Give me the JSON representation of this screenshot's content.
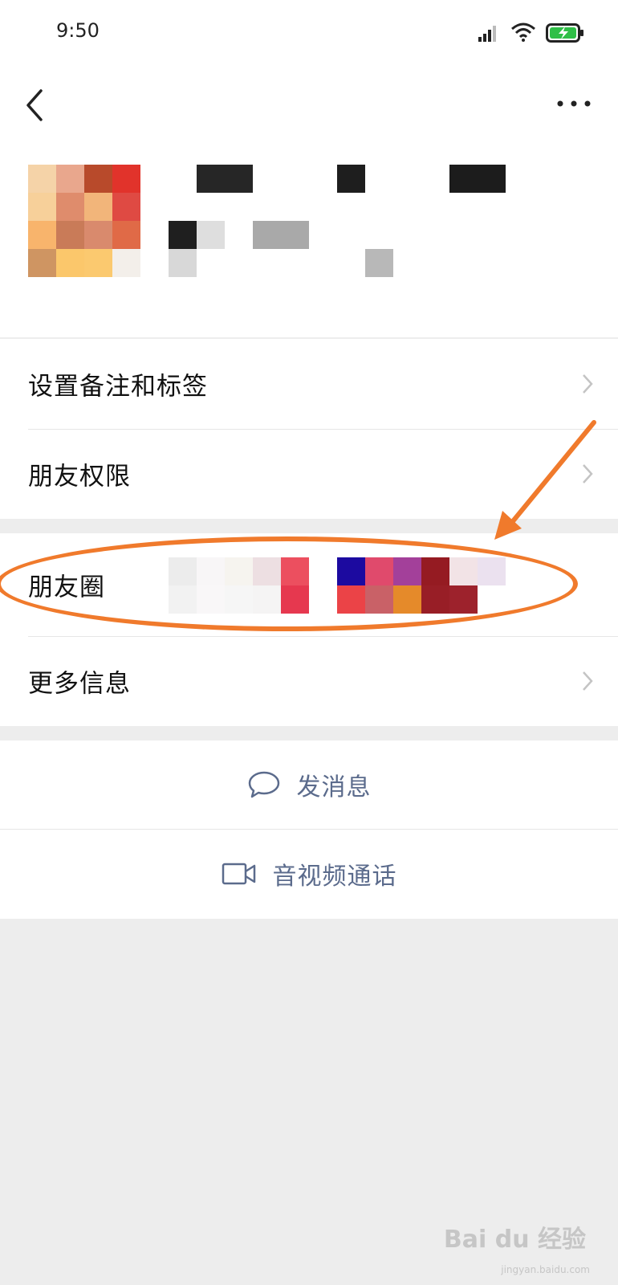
{
  "status_bar": {
    "time": "9:50"
  },
  "menu": {
    "remark_tags": "设置备注和标签",
    "friend_permissions": "朋友权限",
    "moments": "朋友圈",
    "more_info": "更多信息"
  },
  "actions": {
    "send_message": "发消息",
    "video_call": "音视频通话"
  },
  "watermark": {
    "brand": "Bai du 经验",
    "url": "jingyan.baidu.com"
  },
  "colors": {
    "annotation": "#f07a2c",
    "action_text": "#5b6b8c",
    "battery": "#2fbf47"
  }
}
